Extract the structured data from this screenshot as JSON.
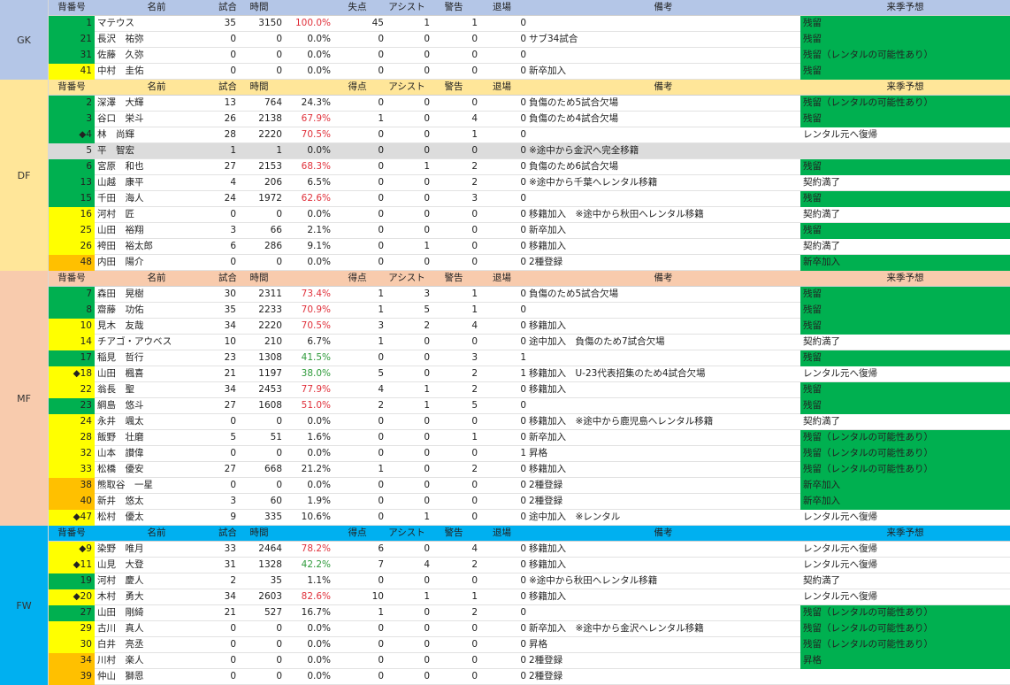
{
  "columns": {
    "number": "背番号",
    "name": "名前",
    "games": "試合",
    "minutes": "時間",
    "goals_gk": "失点",
    "goals": "得点",
    "assists": "アシスト",
    "cards": "警告",
    "red_cards": "退場",
    "notes": "備考",
    "forecast": "来季予想"
  },
  "colors": {
    "gk_bg": "#b4c6e7",
    "df_bg": "#ffe699",
    "mf_bg": "#f8cbad",
    "fw_bg": "#00b0f0",
    "green_num": "#00b050",
    "yellow_num": "#ffff00",
    "orange_num": "#ffc000",
    "gray_num": "#d9d9d9",
    "forecast_green": "#00b050",
    "pct_red": "#e0303a",
    "pct_green": "#2e9a3a"
  },
  "sections": [
    {
      "position": "GK",
      "goals_header": "失点",
      "players": [
        {
          "number": "1",
          "name": "マテウス",
          "games": "35",
          "minutes": "3150",
          "pct": "100.0%",
          "goals": "45",
          "assists": "1",
          "cards": "1",
          "red": "0",
          "note": "",
          "forecast": "残留",
          "num_color": "green",
          "pct_color": "red",
          "forecast_color": "green"
        },
        {
          "number": "21",
          "name": "長沢　祐弥",
          "games": "0",
          "minutes": "0",
          "pct": "0.0%",
          "goals": "0",
          "assists": "0",
          "cards": "0",
          "red": "0",
          "note": "サブ34試合",
          "forecast": "残留",
          "num_color": "green",
          "pct_color": "",
          "forecast_color": "green"
        },
        {
          "number": "31",
          "name": "佐藤　久弥",
          "games": "0",
          "minutes": "0",
          "pct": "0.0%",
          "goals": "0",
          "assists": "0",
          "cards": "0",
          "red": "0",
          "note": "",
          "forecast": "残留（レンタルの可能性あり）",
          "num_color": "green",
          "pct_color": "",
          "forecast_color": "green"
        },
        {
          "number": "41",
          "name": "中村　圭佑",
          "games": "0",
          "minutes": "0",
          "pct": "0.0%",
          "goals": "0",
          "assists": "0",
          "cards": "0",
          "red": "0",
          "note": "新卒加入",
          "forecast": "残留",
          "num_color": "yellow",
          "pct_color": "",
          "forecast_color": "green"
        }
      ]
    },
    {
      "position": "DF",
      "goals_header": "得点",
      "players": [
        {
          "number": "2",
          "name": "深澤　大輝",
          "games": "13",
          "minutes": "764",
          "pct": "24.3%",
          "goals": "0",
          "assists": "0",
          "cards": "0",
          "red": "0",
          "note": "負傷のため5試合欠場",
          "forecast": "残留（レンタルの可能性あり）",
          "num_color": "green",
          "pct_color": "",
          "forecast_color": "green"
        },
        {
          "number": "3",
          "name": "谷口　栄斗",
          "games": "26",
          "minutes": "2138",
          "pct": "67.9%",
          "goals": "1",
          "assists": "0",
          "cards": "4",
          "red": "0",
          "note": "負傷のため4試合欠場",
          "forecast": "残留",
          "num_color": "green",
          "pct_color": "red",
          "forecast_color": "green"
        },
        {
          "number": "◆4",
          "name": "林　尚輝",
          "games": "28",
          "minutes": "2220",
          "pct": "70.5%",
          "goals": "0",
          "assists": "0",
          "cards": "1",
          "red": "0",
          "note": "",
          "forecast": "レンタル元へ復帰",
          "num_color": "green",
          "pct_color": "red",
          "forecast_color": ""
        },
        {
          "number": "5",
          "name": "平　智宏",
          "games": "1",
          "minutes": "1",
          "pct": "0.0%",
          "goals": "0",
          "assists": "0",
          "cards": "0",
          "red": "0",
          "note": "※途中から金沢へ完全移籍",
          "forecast": "",
          "num_color": "gray",
          "pct_color": "",
          "forecast_color": "",
          "row_gray": true
        },
        {
          "number": "6",
          "name": "宮原　和也",
          "games": "27",
          "minutes": "2153",
          "pct": "68.3%",
          "goals": "0",
          "assists": "1",
          "cards": "2",
          "red": "0",
          "note": "負傷のため6試合欠場",
          "forecast": "残留",
          "num_color": "green",
          "pct_color": "red",
          "forecast_color": "green"
        },
        {
          "number": "13",
          "name": "山越　康平",
          "games": "4",
          "minutes": "206",
          "pct": "6.5%",
          "goals": "0",
          "assists": "0",
          "cards": "2",
          "red": "0",
          "note": "※途中から千葉へレンタル移籍",
          "forecast": "契約満了",
          "num_color": "green",
          "pct_color": "",
          "forecast_color": ""
        },
        {
          "number": "15",
          "name": "千田　海人",
          "games": "24",
          "minutes": "1972",
          "pct": "62.6%",
          "goals": "0",
          "assists": "0",
          "cards": "3",
          "red": "0",
          "note": "",
          "forecast": "残留",
          "num_color": "green",
          "pct_color": "red",
          "forecast_color": "green"
        },
        {
          "number": "16",
          "name": "河村　匠",
          "games": "0",
          "minutes": "0",
          "pct": "0.0%",
          "goals": "0",
          "assists": "0",
          "cards": "0",
          "red": "0",
          "note": "移籍加入　※途中から秋田へレンタル移籍",
          "forecast": "契約満了",
          "num_color": "yellow",
          "pct_color": "",
          "forecast_color": ""
        },
        {
          "number": "25",
          "name": "山田　裕翔",
          "games": "3",
          "minutes": "66",
          "pct": "2.1%",
          "goals": "0",
          "assists": "0",
          "cards": "0",
          "red": "0",
          "note": "新卒加入",
          "forecast": "残留",
          "num_color": "yellow",
          "pct_color": "",
          "forecast_color": "green"
        },
        {
          "number": "26",
          "name": "袴田　裕太郎",
          "games": "6",
          "minutes": "286",
          "pct": "9.1%",
          "goals": "0",
          "assists": "1",
          "cards": "0",
          "red": "0",
          "note": "移籍加入",
          "forecast": "契約満了",
          "num_color": "yellow",
          "pct_color": "",
          "forecast_color": ""
        },
        {
          "number": "48",
          "name": "内田　陽介",
          "games": "0",
          "minutes": "0",
          "pct": "0.0%",
          "goals": "0",
          "assists": "0",
          "cards": "0",
          "red": "0",
          "note": "2種登録",
          "forecast": "新卒加入",
          "num_color": "orange",
          "pct_color": "",
          "forecast_color": "green"
        }
      ]
    },
    {
      "position": "MF",
      "goals_header": "得点",
      "players": [
        {
          "number": "7",
          "name": "森田　晃樹",
          "games": "30",
          "minutes": "2311",
          "pct": "73.4%",
          "goals": "1",
          "assists": "3",
          "cards": "1",
          "red": "0",
          "note": "負傷のため5試合欠場",
          "forecast": "残留",
          "num_color": "green",
          "pct_color": "red",
          "forecast_color": "green"
        },
        {
          "number": "8",
          "name": "齋藤　功佑",
          "games": "35",
          "minutes": "2233",
          "pct": "70.9%",
          "goals": "1",
          "assists": "5",
          "cards": "1",
          "red": "0",
          "note": "",
          "forecast": "残留",
          "num_color": "green",
          "pct_color": "red",
          "forecast_color": "green"
        },
        {
          "number": "10",
          "name": "見木　友哉",
          "games": "34",
          "minutes": "2220",
          "pct": "70.5%",
          "goals": "3",
          "assists": "2",
          "cards": "4",
          "red": "0",
          "note": "移籍加入",
          "forecast": "残留",
          "num_color": "yellow",
          "pct_color": "red",
          "forecast_color": "green"
        },
        {
          "number": "14",
          "name": "チアゴ・アウベス",
          "games": "10",
          "minutes": "210",
          "pct": "6.7%",
          "goals": "1",
          "assists": "0",
          "cards": "0",
          "red": "0",
          "note": "途中加入　負傷のため7試合欠場",
          "forecast": "契約満了",
          "num_color": "yellow",
          "pct_color": "",
          "forecast_color": ""
        },
        {
          "number": "17",
          "name": "稲見　哲行",
          "games": "23",
          "minutes": "1308",
          "pct": "41.5%",
          "goals": "0",
          "assists": "0",
          "cards": "3",
          "red": "1",
          "note": "",
          "forecast": "残留",
          "num_color": "green",
          "pct_color": "green",
          "forecast_color": "green"
        },
        {
          "number": "◆18",
          "name": "山田　楓喜",
          "games": "21",
          "minutes": "1197",
          "pct": "38.0%",
          "goals": "5",
          "assists": "0",
          "cards": "2",
          "red": "1",
          "note": "移籍加入　U-23代表招集のため4試合欠場",
          "forecast": "レンタル元へ復帰",
          "num_color": "yellow",
          "pct_color": "green",
          "forecast_color": ""
        },
        {
          "number": "22",
          "name": "翁長　聖",
          "games": "34",
          "minutes": "2453",
          "pct": "77.9%",
          "goals": "4",
          "assists": "1",
          "cards": "2",
          "red": "0",
          "note": "移籍加入",
          "forecast": "残留",
          "num_color": "yellow",
          "pct_color": "red",
          "forecast_color": "green"
        },
        {
          "number": "23",
          "name": "綱島　悠斗",
          "games": "27",
          "minutes": "1608",
          "pct": "51.0%",
          "goals": "2",
          "assists": "1",
          "cards": "5",
          "red": "0",
          "note": "",
          "forecast": "残留",
          "num_color": "green",
          "pct_color": "red",
          "forecast_color": "green"
        },
        {
          "number": "24",
          "name": "永井　颯太",
          "games": "0",
          "minutes": "0",
          "pct": "0.0%",
          "goals": "0",
          "assists": "0",
          "cards": "0",
          "red": "0",
          "note": "移籍加入　※途中から鹿児島へレンタル移籍",
          "forecast": "契約満了",
          "num_color": "yellow",
          "pct_color": "",
          "forecast_color": ""
        },
        {
          "number": "28",
          "name": "飯野　壮磨",
          "games": "5",
          "minutes": "51",
          "pct": "1.6%",
          "goals": "0",
          "assists": "0",
          "cards": "1",
          "red": "0",
          "note": "新卒加入",
          "forecast": "残留（レンタルの可能性あり）",
          "num_color": "yellow",
          "pct_color": "",
          "forecast_color": "green"
        },
        {
          "number": "32",
          "name": "山本　讃偉",
          "games": "0",
          "minutes": "0",
          "pct": "0.0%",
          "goals": "0",
          "assists": "0",
          "cards": "0",
          "red": "1",
          "note": "昇格",
          "forecast": "残留（レンタルの可能性あり）",
          "num_color": "yellow",
          "pct_color": "",
          "forecast_color": "green"
        },
        {
          "number": "33",
          "name": "松橋　優安",
          "games": "27",
          "minutes": "668",
          "pct": "21.2%",
          "goals": "1",
          "assists": "0",
          "cards": "2",
          "red": "0",
          "note": "移籍加入",
          "forecast": "残留（レンタルの可能性あり）",
          "num_color": "yellow",
          "pct_color": "",
          "forecast_color": "green"
        },
        {
          "number": "38",
          "name": "熊取谷　一星",
          "games": "0",
          "minutes": "0",
          "pct": "0.0%",
          "goals": "0",
          "assists": "0",
          "cards": "0",
          "red": "0",
          "note": "2種登録",
          "forecast": "新卒加入",
          "num_color": "orange",
          "pct_color": "",
          "forecast_color": "green"
        },
        {
          "number": "40",
          "name": "新井　悠太",
          "games": "3",
          "minutes": "60",
          "pct": "1.9%",
          "goals": "0",
          "assists": "0",
          "cards": "0",
          "red": "0",
          "note": "2種登録",
          "forecast": "新卒加入",
          "num_color": "orange",
          "pct_color": "",
          "forecast_color": "green"
        },
        {
          "number": "◆47",
          "name": "松村　優太",
          "games": "9",
          "minutes": "335",
          "pct": "10.6%",
          "goals": "0",
          "assists": "1",
          "cards": "0",
          "red": "0",
          "note": "途中加入　※レンタル",
          "forecast": "レンタル元へ復帰",
          "num_color": "yellow",
          "pct_color": "",
          "forecast_color": ""
        }
      ]
    },
    {
      "position": "FW",
      "goals_header": "得点",
      "players": [
        {
          "number": "◆9",
          "name": "染野　唯月",
          "games": "33",
          "minutes": "2464",
          "pct": "78.2%",
          "goals": "6",
          "assists": "0",
          "cards": "4",
          "red": "0",
          "note": "移籍加入",
          "forecast": "レンタル元へ復帰",
          "num_color": "yellow",
          "pct_color": "red",
          "forecast_color": ""
        },
        {
          "number": "◆11",
          "name": "山見　大登",
          "games": "31",
          "minutes": "1328",
          "pct": "42.2%",
          "goals": "7",
          "assists": "4",
          "cards": "2",
          "red": "0",
          "note": "移籍加入",
          "forecast": "レンタル元へ復帰",
          "num_color": "yellow",
          "pct_color": "green",
          "forecast_color": ""
        },
        {
          "number": "19",
          "name": "河村　慶人",
          "games": "2",
          "minutes": "35",
          "pct": "1.1%",
          "goals": "0",
          "assists": "0",
          "cards": "0",
          "red": "0",
          "note": "※途中から秋田へレンタル移籍",
          "forecast": "契約満了",
          "num_color": "green",
          "pct_color": "",
          "forecast_color": ""
        },
        {
          "number": "◆20",
          "name": "木村　勇大",
          "games": "34",
          "minutes": "2603",
          "pct": "82.6%",
          "goals": "10",
          "assists": "1",
          "cards": "1",
          "red": "0",
          "note": "移籍加入",
          "forecast": "レンタル元へ復帰",
          "num_color": "yellow",
          "pct_color": "red",
          "forecast_color": ""
        },
        {
          "number": "27",
          "name": "山田　剛綺",
          "games": "21",
          "minutes": "527",
          "pct": "16.7%",
          "goals": "1",
          "assists": "0",
          "cards": "2",
          "red": "0",
          "note": "",
          "forecast": "残留（レンタルの可能性あり）",
          "num_color": "green",
          "pct_color": "",
          "forecast_color": "green"
        },
        {
          "number": "29",
          "name": "古川　真人",
          "games": "0",
          "minutes": "0",
          "pct": "0.0%",
          "goals": "0",
          "assists": "0",
          "cards": "0",
          "red": "0",
          "note": "新卒加入　※途中から金沢へレンタル移籍",
          "forecast": "残留（レンタルの可能性あり）",
          "num_color": "yellow",
          "pct_color": "",
          "forecast_color": "green"
        },
        {
          "number": "30",
          "name": "白井　亮丞",
          "games": "0",
          "minutes": "0",
          "pct": "0.0%",
          "goals": "0",
          "assists": "0",
          "cards": "0",
          "red": "0",
          "note": "昇格",
          "forecast": "残留（レンタルの可能性あり）",
          "num_color": "yellow",
          "pct_color": "",
          "forecast_color": "green"
        },
        {
          "number": "34",
          "name": "川村　楽人",
          "games": "0",
          "minutes": "0",
          "pct": "0.0%",
          "goals": "0",
          "assists": "0",
          "cards": "0",
          "red": "0",
          "note": "2種登録",
          "forecast": "昇格",
          "num_color": "orange",
          "pct_color": "",
          "forecast_color": "green"
        },
        {
          "number": "39",
          "name": "仲山　獅恩",
          "games": "0",
          "minutes": "0",
          "pct": "0.0%",
          "goals": "0",
          "assists": "0",
          "cards": "0",
          "red": "0",
          "note": "2種登録",
          "forecast": "",
          "num_color": "orange",
          "pct_color": "",
          "forecast_color": ""
        }
      ]
    }
  ]
}
